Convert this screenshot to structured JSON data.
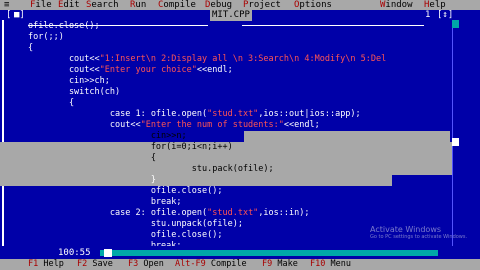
{
  "menubar": {
    "system_icon": "≡",
    "items": [
      {
        "label": "File",
        "hot": "F",
        "rest": "ile"
      },
      {
        "label": "Edit",
        "hot": "E",
        "rest": "dit"
      },
      {
        "label": "Search",
        "hot": "S",
        "rest": "earch"
      },
      {
        "label": "Run",
        "hot": "R",
        "rest": "un"
      },
      {
        "label": "Compile",
        "hot": "C",
        "rest": "ompile"
      },
      {
        "label": "Debug",
        "hot": "D",
        "rest": "ebug"
      },
      {
        "label": "Project",
        "hot": "P",
        "rest": "roject"
      },
      {
        "label": "Options",
        "hot": "O",
        "rest": "ptions"
      },
      {
        "label": "Window",
        "hot": "W",
        "rest": "indow"
      },
      {
        "label": "Help",
        "hot": "H",
        "rest": "elp"
      }
    ]
  },
  "window": {
    "frame_left": "[",
    "close_label": "■]",
    "title": "MIT.CPP",
    "number": "1",
    "zoom_label": "[↕]"
  },
  "editor": {
    "lines": [
      {
        "segs": [
          {
            "t": "ofile.close();"
          }
        ]
      },
      {
        "segs": [
          {
            "t": "for(;;)"
          }
        ]
      },
      {
        "segs": [
          {
            "t": "{"
          }
        ]
      },
      {
        "segs": [
          {
            "t": "        cout<<"
          },
          {
            "t": "\"1:Insert\\n 2:Display all \\n 3:Search\\n 4:Modify\\n 5:Del",
            "c": "str"
          }
        ]
      },
      {
        "segs": [
          {
            "t": "        cout<<"
          },
          {
            "t": "\"Enter your choice\"",
            "c": "str"
          },
          {
            "t": "<<endl;"
          }
        ]
      },
      {
        "segs": [
          {
            "t": "        cin>>ch;"
          }
        ]
      },
      {
        "segs": [
          {
            "t": "        switch(ch)"
          }
        ]
      },
      {
        "segs": [
          {
            "t": "        {"
          }
        ]
      },
      {
        "segs": [
          {
            "t": "                case 1: ofile.open("
          },
          {
            "t": "\"stud.txt\"",
            "c": "str"
          },
          {
            "t": ",ios::out|ios::app);"
          }
        ]
      },
      {
        "segs": [
          {
            "t": "                cout<<"
          },
          {
            "t": "\"Enter the num of students:\"",
            "c": "str"
          },
          {
            "t": "<<endl;"
          }
        ]
      },
      {
        "segs": [
          {
            "t": "                        cin>>n;"
          }
        ]
      },
      {
        "segs": [
          {
            "t": "                        for(i=0;i<n;i++)"
          }
        ]
      },
      {
        "segs": [
          {
            "t": "                        {"
          }
        ]
      },
      {
        "segs": [
          {
            "t": "                                stu.pack(ofile);"
          }
        ]
      },
      {
        "segs": [
          {
            "t": "                        }"
          }
        ]
      },
      {
        "segs": [
          {
            "t": "                        ofile.close();"
          }
        ]
      },
      {
        "segs": [
          {
            "t": "                        break;"
          }
        ]
      },
      {
        "segs": [
          {
            "t": "                case 2: ofile.open("
          },
          {
            "t": "\"stud.txt\"",
            "c": "str"
          },
          {
            "t": ",ios::in);"
          }
        ]
      },
      {
        "segs": [
          {
            "t": "                        stu.unpack(ofile);"
          }
        ]
      },
      {
        "segs": [
          {
            "t": "                        ofile.close();"
          }
        ]
      },
      {
        "segs": [
          {
            "t": "                        break;"
          }
        ]
      }
    ]
  },
  "status": {
    "position": "100:55"
  },
  "keybar": {
    "items": [
      {
        "key": "F1",
        "label": " Help"
      },
      {
        "key": "F2",
        "label": " Save"
      },
      {
        "key": "F3",
        "label": " Open"
      },
      {
        "key": "Alt-F9",
        "label": " Compile"
      },
      {
        "key": "F9",
        "label": " Make"
      },
      {
        "key": "F10",
        "label": " Menu"
      }
    ]
  },
  "watermark": {
    "line1": "Activate Windows",
    "line2": "Go to PC settings to activate Windows."
  }
}
